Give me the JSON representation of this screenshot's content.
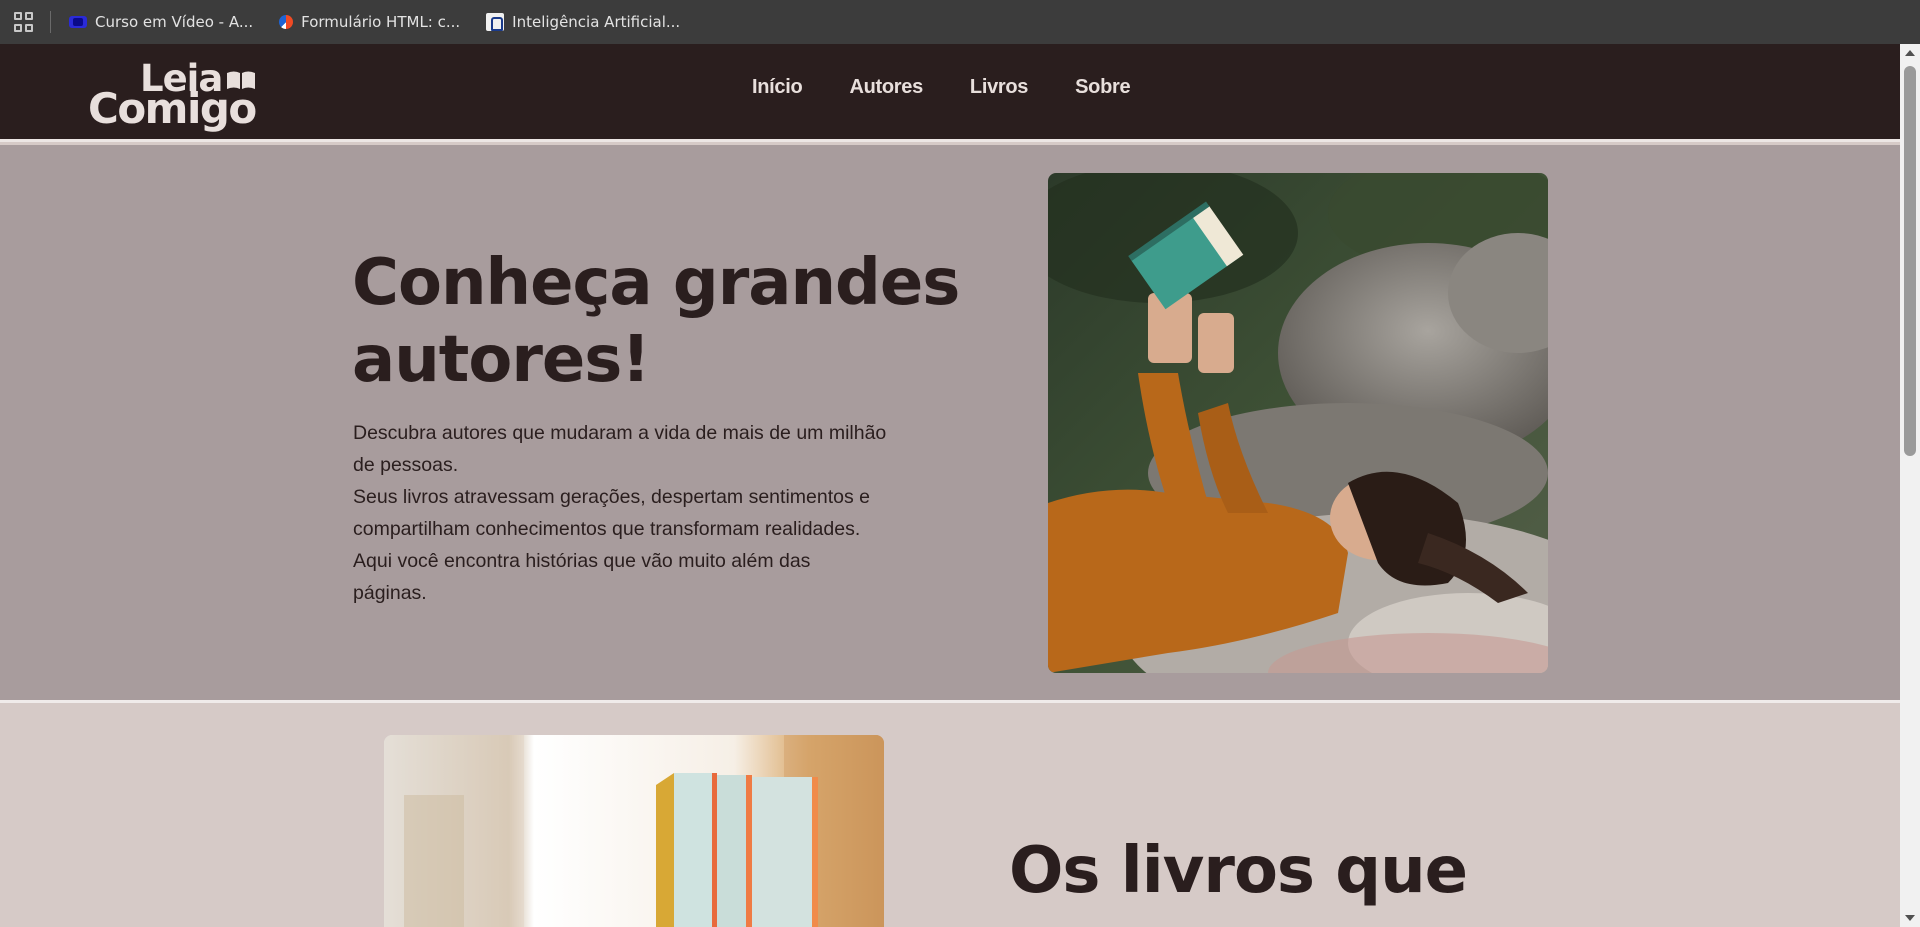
{
  "bookmarks": [
    {
      "label": "Curso em Vídeo - A...",
      "icon": "curso-em-video-favicon"
    },
    {
      "label": "Formulário HTML: c...",
      "icon": "formulario-favicon"
    },
    {
      "label": "Inteligência Artificial...",
      "icon": "lock-favicon"
    }
  ],
  "header": {
    "logo_line1": "Leia",
    "logo_line2": "Comigo",
    "nav": [
      "Início",
      "Autores",
      "Livros",
      "Sobre"
    ]
  },
  "hero": {
    "title": "Conheça grandes autores!",
    "paragraph": "Descubra autores que mudaram a vida de mais de um milhão de pessoas.",
    "paragraph2": "Seus livros atravessam gerações, despertam sentimentos e compartilham conhecimentos que transformam realidades. Aqui você encontra histórias que vão muito além das páginas."
  },
  "section2": {
    "title": "Os livros que"
  },
  "colors": {
    "header_bg": "#2a1e1e",
    "hero_bg": "#a89c9d",
    "section2_bg": "#d6cac7",
    "text_dark": "#2a1e1e",
    "text_light": "#e8dfdc"
  }
}
